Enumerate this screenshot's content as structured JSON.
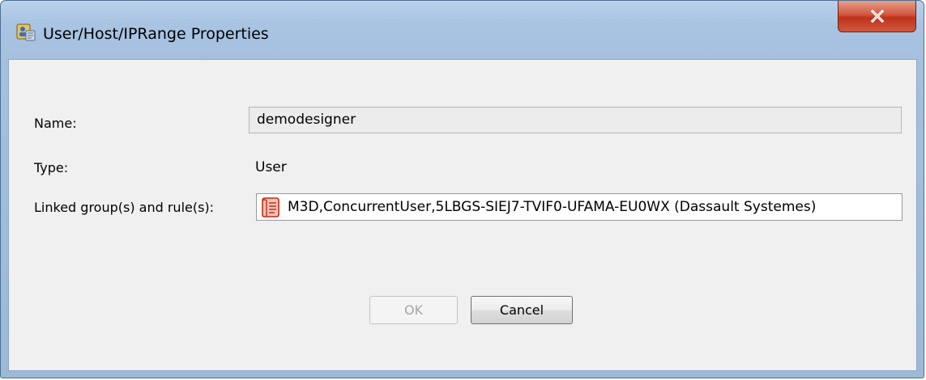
{
  "window": {
    "title": "User/Host/IPRange Properties",
    "app_icon": "user-properties-icon",
    "close_icon": "close-icon",
    "close_symbol": "x"
  },
  "form": {
    "name_label": "Name:",
    "name_value": "demodesigner",
    "type_label": "Type:",
    "type_value": "User",
    "linked_label": "Linked group(s) and rule(s):",
    "linked_icon": "rule-document-icon",
    "linked_value": "M3D,ConcurrentUser,5LBGS-SIEJ7-TVIF0-UFAMA-EU0WX (Dassault Systemes)"
  },
  "buttons": {
    "ok_label": "OK",
    "ok_enabled": false,
    "cancel_label": "Cancel"
  },
  "colors": {
    "close_button": "#c7402a",
    "frame": "#a8c4e2",
    "client_bg": "#f0f0f0",
    "rule_icon": "#d9381e"
  }
}
